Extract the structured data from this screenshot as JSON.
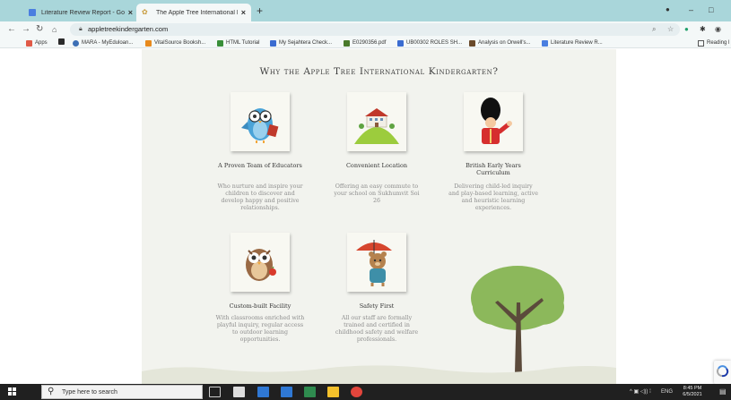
{
  "browser": {
    "tabs": [
      {
        "title": "Literature Review Report - Googl",
        "active": false
      },
      {
        "title": "The Apple Tree International Kin",
        "active": true
      }
    ],
    "new_tab_label": "+",
    "window_controls": {
      "minimize": "–",
      "maximize": "□"
    },
    "url": "appletreekindergarten.com",
    "bookmarks": [
      {
        "label": "Apps",
        "color": "#e05a47"
      },
      {
        "label": "",
        "color": "#2b2b2b"
      },
      {
        "label": "MARA - MyEduloan...",
        "color": "#3d6fb5"
      },
      {
        "label": "VitalSource Booksh...",
        "color": "#e88a1e"
      },
      {
        "label": "HTML Tutorial",
        "color": "#3a8f3a"
      },
      {
        "label": "My Sejahtera Check...",
        "color": "#3b6cd1"
      },
      {
        "label": "E0290356.pdf",
        "color": "#4a7a2b"
      },
      {
        "label": "UB00302 ROLES SH...",
        "color": "#3b6cd1"
      },
      {
        "label": "Analysis on Orwell's...",
        "color": "#6a4a2b"
      },
      {
        "label": "Literature Review R...",
        "color": "#4a7ee0"
      }
    ],
    "reading_list": "Reading l"
  },
  "page": {
    "heading": "Why the Apple Tree International Kindergarten?",
    "features": [
      {
        "title": "A Proven Team of Educators",
        "description": "Who nurture and inspire your children to discover and develop happy and positive relationships."
      },
      {
        "title": "Convenient Location",
        "description": "Offering an easy commute to your school on Sukhumvit Soi 26"
      },
      {
        "title": "British Early Years Curriculum",
        "description": "Delivering child-led inquiry and play-based learning, active and heuristic learning experiences."
      },
      {
        "title": "Custom-built Facility",
        "description": "With classrooms enriched with playful inquiry, regular access to outdoor learning opportunities."
      },
      {
        "title": "Safety First",
        "description": "All our staff are formally trained and certified in childhood safety and welfare professionals."
      }
    ],
    "colors": {
      "background": "#f2f3ee",
      "tree_green": "#8cb85b",
      "trunk": "#5b4a3b"
    }
  },
  "taskbar": {
    "search_placeholder": "Type here to search",
    "language": "ENG",
    "time": "8:45 PM",
    "date": "6/5/2021",
    "apps": [
      {
        "name": "task-view-icon",
        "color": "#cccccc"
      },
      {
        "name": "store-icon",
        "color": "#dddddd"
      },
      {
        "name": "mail-icon",
        "color": "#2f78d4"
      },
      {
        "name": "calculator-icon",
        "color": "#2f78d4"
      },
      {
        "name": "excel-icon",
        "color": "#2f8b4f"
      },
      {
        "name": "file-explorer-icon",
        "color": "#f3c02b"
      },
      {
        "name": "chrome-icon",
        "color": "#e2453c"
      }
    ]
  }
}
